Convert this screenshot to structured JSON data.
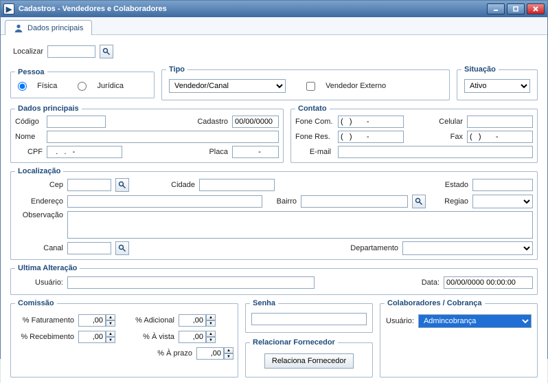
{
  "window": {
    "title": "Cadastros -   Vendedores e Colaboradores"
  },
  "tab": {
    "label": "Dados principais"
  },
  "search": {
    "label": "Localizar"
  },
  "pessoa": {
    "legend": "Pessoa",
    "fisica": "Física",
    "juridica": "Jurídica"
  },
  "tipo": {
    "legend": "Tipo",
    "value": "Vendedor/Canal",
    "externo": "Vendedor Externo"
  },
  "situacao": {
    "legend": "Situação",
    "value": "Ativo"
  },
  "dados": {
    "legend": "Dados principais",
    "codigo": "Código",
    "cadastro": "Cadastro",
    "cadastro_val": "00/00/0000",
    "nome": "Nome",
    "cpf": "CPF",
    "cpf_val": "   .   .   -",
    "placa": "Placa",
    "placa_val": "    -"
  },
  "contato": {
    "legend": "Contato",
    "fone_com": "Fone Com.",
    "fone_res": "Fone Res.",
    "cel": "Celular",
    "fax": "Fax",
    "email": "E-mail",
    "phmask": "(   )       -"
  },
  "loc": {
    "legend": "Localização",
    "cep": "Cep",
    "cidade": "Cidade",
    "estado": "Estado",
    "endereco": "Endereço",
    "bairro": "Bairro",
    "regiao": "Regiao",
    "obs": "Observação",
    "canal": "Canal",
    "depto": "Departamento"
  },
  "alt": {
    "legend": "Ultima Alteração",
    "usuario": "Usuário:",
    "data": "Data:",
    "data_val": "00/00/0000 00:00:00"
  },
  "comissao": {
    "legend": "Comissão",
    "fat": "% Faturamento",
    "rec": "% Recebimento",
    "adic": "% Adicional",
    "avista": "% À vista",
    "aprazo": "% À prazo",
    "val": ",00"
  },
  "senha": {
    "legend": "Senha"
  },
  "rel": {
    "legend": "Relacionar Fornecedor",
    "btn": "Relaciona Fornecedor"
  },
  "colab": {
    "legend": "Colaboradores / Cobrança",
    "usuario": "Usuário:",
    "value": "Admincobrança"
  }
}
